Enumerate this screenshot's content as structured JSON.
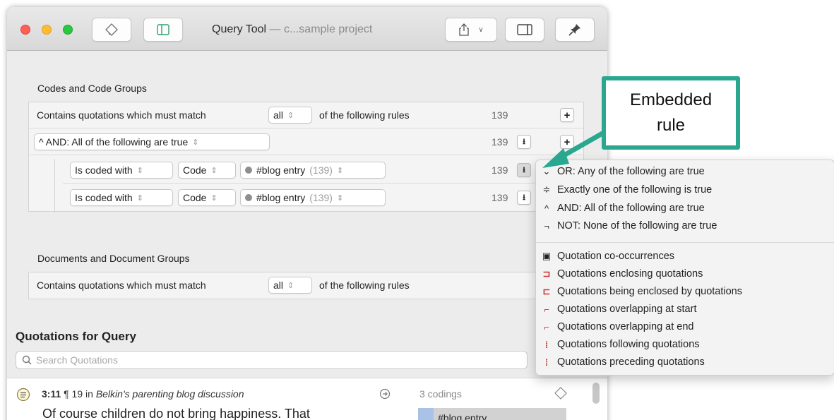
{
  "window": {
    "title_main": "Query Tool",
    "title_sep": " — ",
    "title_project": "c...sample project"
  },
  "toolbar": {
    "tag_icon": "tag-outline-icon",
    "sidebar_icon": "sidebar-icon",
    "share_icon": "share-icon",
    "inspector_icon": "inspector-icon",
    "pin_icon": "pin-icon"
  },
  "codes_section": {
    "label": "Codes and Code Groups",
    "header": {
      "prefix": "Contains quotations which must match",
      "match": "all",
      "suffix": "of the following rules",
      "count": "139"
    },
    "group_rule": {
      "label": "^ AND: All of the following are true",
      "count": "139"
    },
    "rules": [
      {
        "condition": "Is coded with",
        "type": "Code",
        "code": "#blog entry",
        "code_count": "(139)",
        "count": "139"
      },
      {
        "condition": "Is coded with",
        "type": "Code",
        "code": "#blog entry",
        "code_count": "(139)",
        "count": "139"
      }
    ]
  },
  "documents_section": {
    "label": "Documents and Document Groups",
    "header": {
      "prefix": "Contains quotations which must match",
      "match": "all",
      "suffix": "of the following rules"
    }
  },
  "quotations": {
    "title": "Quotations for Query",
    "search_placeholder": "Search Quotations",
    "items": [
      {
        "id": "3:11",
        "para": "¶ 19 in",
        "document": "Belkin's parenting blog discussion",
        "text": "Of course children do not bring happiness. That",
        "codings": "3 codings",
        "code": "#blog entry"
      }
    ]
  },
  "menu": {
    "items": [
      {
        "icon": "⌄",
        "label": "OR: Any of the following are true"
      },
      {
        "icon": "≑",
        "label": "Exactly one of the following is true"
      },
      {
        "icon": "^",
        "label": "AND: All of the following are true"
      },
      {
        "icon": "¬",
        "label": "NOT: None of the following are true"
      }
    ],
    "quotation_items": [
      {
        "icon": "▣",
        "label": "Quotation co-occurrences"
      },
      {
        "icon": "⊐",
        "label": "Quotations enclosing quotations"
      },
      {
        "icon": "⊏",
        "label": "Quotations being enclosed by quotations"
      },
      {
        "icon": "⌐",
        "label": "Quotations overlapping at start"
      },
      {
        "icon": "⌐",
        "label": "Quotations overlapping at end"
      },
      {
        "icon": "⁞",
        "label": "Quotations following quotations"
      },
      {
        "icon": "⁞",
        "label": "Quotations preceding quotations"
      }
    ]
  },
  "annotation": {
    "line1": "Embedded",
    "line2": "rule",
    "color": "#29a88f"
  }
}
